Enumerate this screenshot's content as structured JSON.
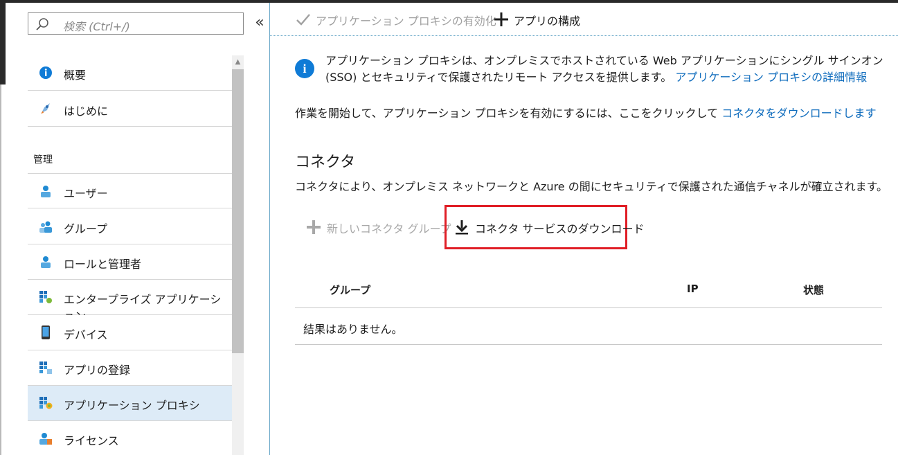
{
  "search": {
    "placeholder": "検索 (Ctrl+/)"
  },
  "sidebar": {
    "collapse_label": "«",
    "items": [
      {
        "label": "概要",
        "icon": "info-icon"
      },
      {
        "label": "はじめに",
        "icon": "rocket-icon"
      }
    ],
    "section_label": "管理",
    "manage_items": [
      {
        "label": "ユーザー",
        "icon": "user-icon"
      },
      {
        "label": "グループ",
        "icon": "group-icon"
      },
      {
        "label": "ロールと管理者",
        "icon": "role-icon"
      },
      {
        "label": "エンタープライズ アプリケーション",
        "icon": "enterprise-app-icon"
      },
      {
        "label": "デバイス",
        "icon": "device-icon"
      },
      {
        "label": "アプリの登録",
        "icon": "app-registration-icon"
      },
      {
        "label": "アプリケーション プロキシ",
        "icon": "app-proxy-icon",
        "active": true
      },
      {
        "label": "ライセンス",
        "icon": "license-icon"
      }
    ]
  },
  "toolbar": {
    "enable_proxy_label": "アプリケーション プロキシの有効化",
    "configure_app_label": "アプリの構成"
  },
  "info": {
    "text": "アプリケーション プロキシは、オンプレミスでホストされている Web アプリケーションにシングル サインオン (SSO) とセキュリティで保護されたリモート アクセスを提供します。",
    "link": "アプリケーション プロキシの詳細情報"
  },
  "start": {
    "text": "作業を開始して、アプリケーション プロキシを有効にするには、ここをクリックして",
    "link": "コネクタをダウンロードします"
  },
  "connectors": {
    "title": "コネクタ",
    "description": "コネクタにより、オンプレミス ネットワークと Azure の間にセキュリティで保護された通信チャネルが確立されます。",
    "new_group_label": "新しいコネクタ グループ",
    "download_label": "コネクタ サービスのダウンロード"
  },
  "table": {
    "columns": [
      "グループ",
      "IP",
      "状態"
    ],
    "empty_message": "結果はありません。"
  },
  "colors": {
    "accent": "#0f6cbd",
    "highlight_border": "#e01e26",
    "active_bg": "#ddebf7"
  }
}
